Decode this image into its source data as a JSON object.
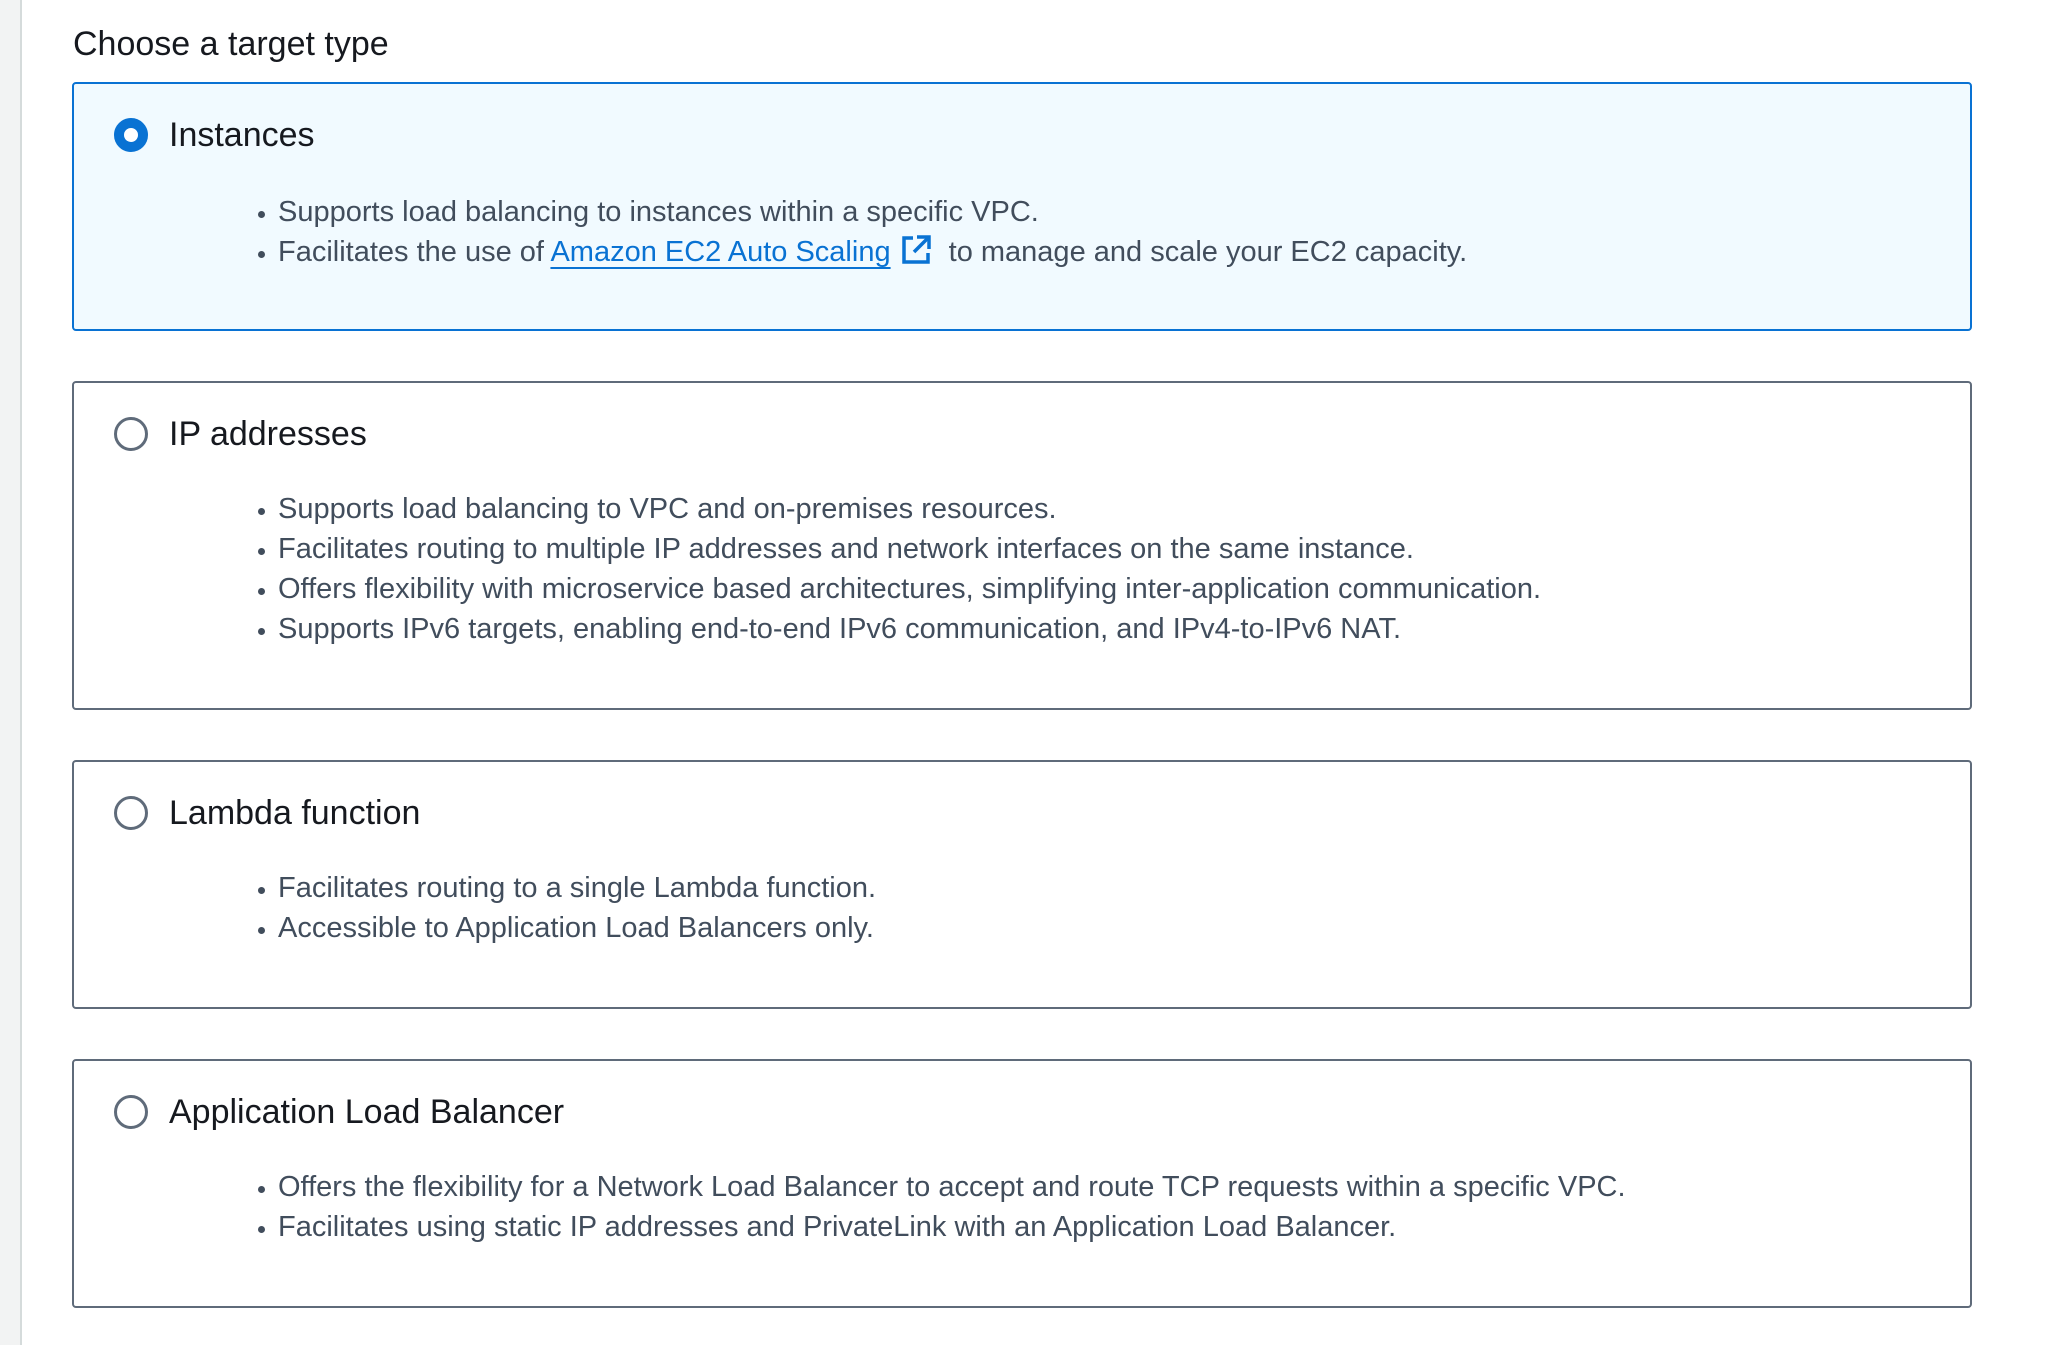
{
  "section": {
    "label": "Choose a target type"
  },
  "options": [
    {
      "title": "Instances",
      "selected": true,
      "bullets": [
        "Supports load balancing to instances within a specific VPC."
      ],
      "bullet_with_link": {
        "before": "Facilitates the use of ",
        "link_text": "Amazon EC2 Auto Scaling",
        "link_icon": "external-link-icon",
        "after": " to manage and scale your EC2 capacity."
      }
    },
    {
      "title": "IP addresses",
      "selected": false,
      "bullets": [
        "Supports load balancing to VPC and on-premises resources.",
        "Facilitates routing to multiple IP addresses and network interfaces on the same instance.",
        "Offers flexibility with microservice based architectures, simplifying inter-application communication.",
        "Supports IPv6 targets, enabling end-to-end IPv6 communication, and IPv4-to-IPv6 NAT."
      ]
    },
    {
      "title": "Lambda function",
      "selected": false,
      "bullets": [
        "Facilitates routing to a single Lambda function.",
        "Accessible to Application Load Balancers only."
      ]
    },
    {
      "title": "Application Load Balancer",
      "selected": false,
      "bullets": [
        "Offers the flexibility for a Network Load Balancer to accept and route TCP requests within a specific VPC.",
        "Facilitates using static IP addresses and PrivateLink with an Application Load Balancer."
      ]
    }
  ],
  "colors": {
    "accent": "#0972d3",
    "selected_background": "#f1faff",
    "border": "#5f6b7a",
    "body_text": "#414d5c",
    "heading_text": "#16191f"
  }
}
